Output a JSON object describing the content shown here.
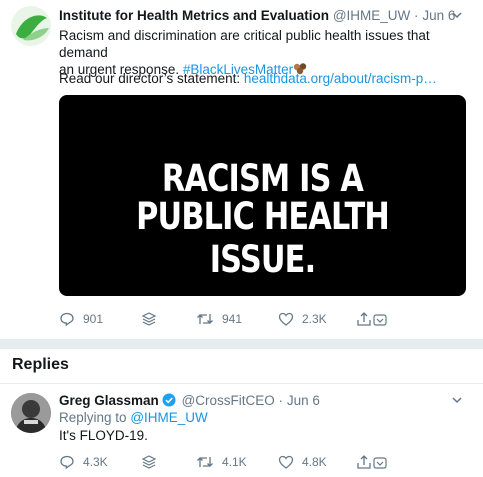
{
  "tweet": {
    "author_name": "Institute for Health Metrics and Evaluation",
    "author_handle": "@IHME_UW",
    "separator": "·",
    "date": "Jun 6",
    "text_line1": "Racism and discrimination are critical public health issues that demand",
    "text_line2_plain": "an urgent response.",
    "hashtag": "#BlackLivesMatter",
    "statement_prefix": "Read our director’s statement:",
    "statement_link": "healthdata.org/about/racism-p…",
    "media_line1": "RACISM IS A",
    "media_line2": "PUBLIC HEALTH ISSUE.",
    "actions": {
      "replies": "901",
      "retweets": "941",
      "likes": "2.3K"
    }
  },
  "replies_section": {
    "title": "Replies"
  },
  "reply": {
    "author_name": "Greg Glassman",
    "author_handle": "@CrossFitCEO",
    "separator": "·",
    "date": "Jun 6",
    "replying_prefix": "Replying to",
    "replying_handle": "@IHME_UW",
    "text": "It's FLOYD-19.",
    "actions": {
      "replies": "4.3K",
      "retweets": "4.1K",
      "likes": "4.8K"
    }
  },
  "icons": [
    "ihme-logo-icon",
    "chevron-down-icon",
    "fist-emoji-icon",
    "reply-icon",
    "stack-icon",
    "retweet-icon",
    "like-icon",
    "share-icon",
    "verified-icon",
    "avatar-photo-icon"
  ],
  "colors": {
    "link": "#1b95e0",
    "muted": "#657786",
    "verified": "#1da1f2",
    "logo_green": "#3cae3f"
  }
}
